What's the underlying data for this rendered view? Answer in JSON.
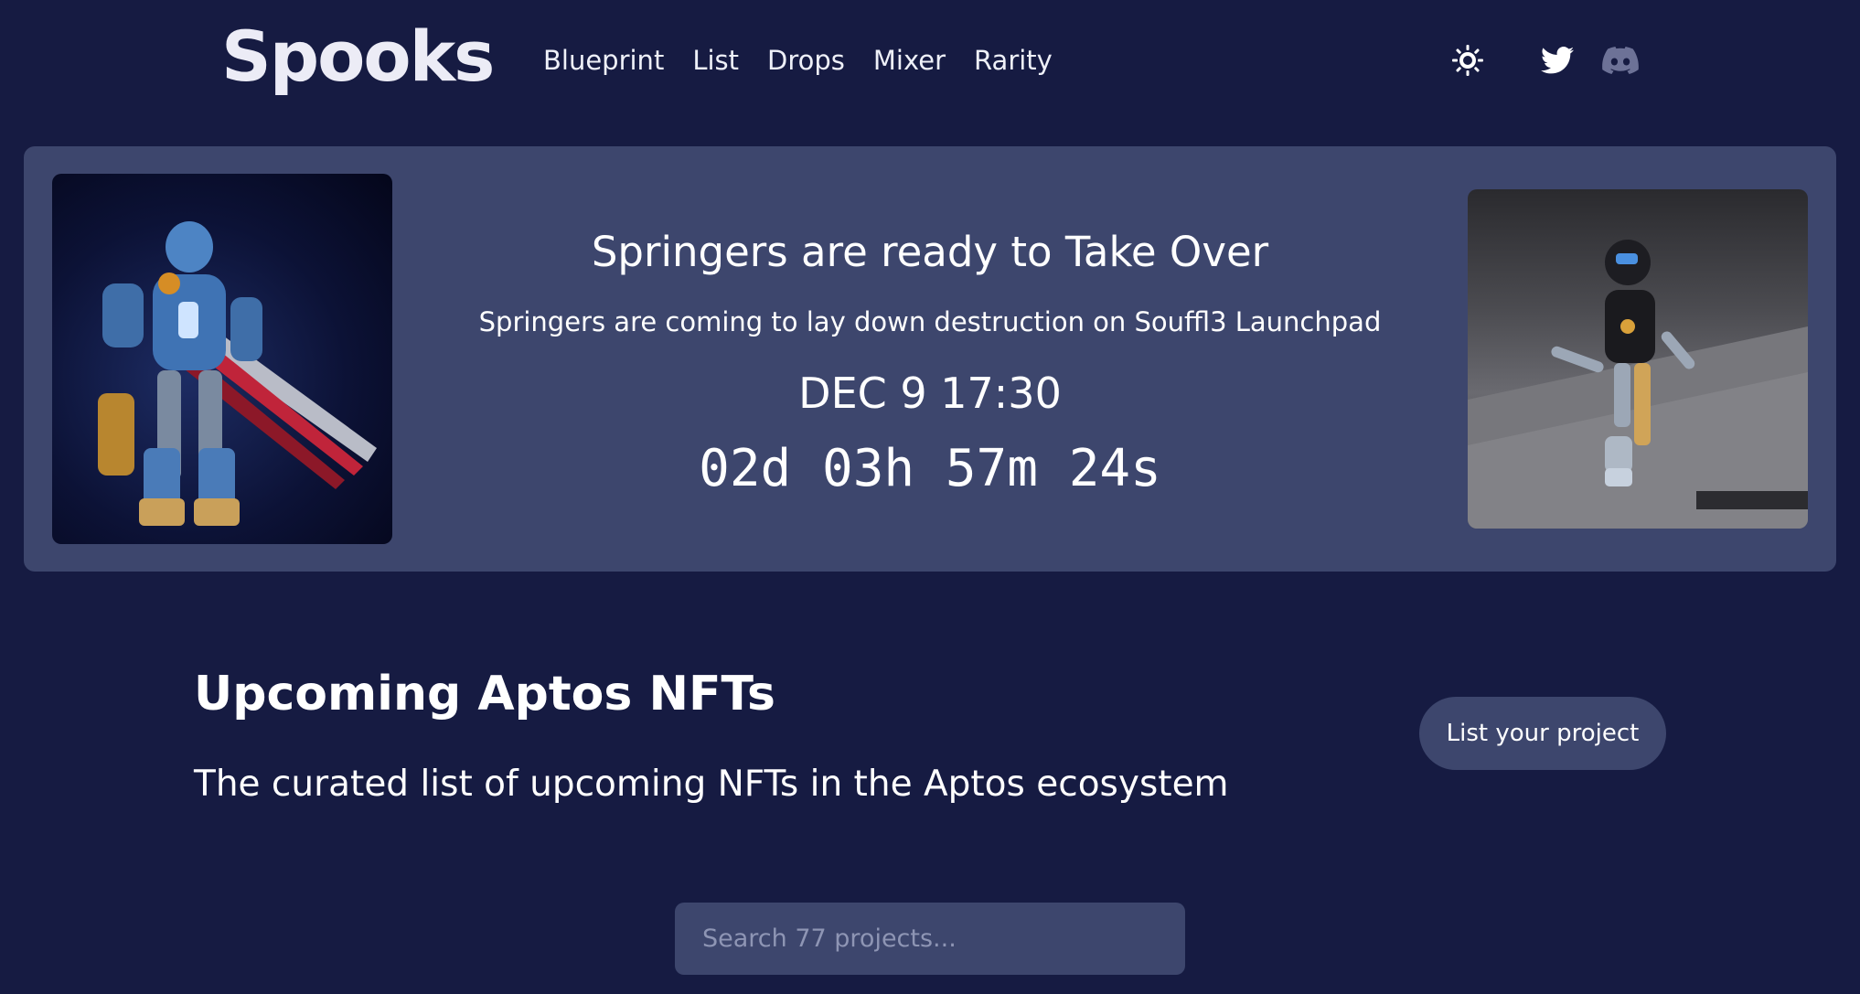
{
  "header": {
    "logo": "Spooks",
    "nav": [
      "Blueprint",
      "List",
      "Drops",
      "Mixer",
      "Rarity"
    ],
    "icons": [
      "theme-sun-icon",
      "twitter-icon",
      "discord-icon"
    ]
  },
  "banner": {
    "title": "Springers are ready to Take Over",
    "subtitle": "Springers are coming to lay down destruction on Souffl3 Launchpad",
    "date": "DEC 9 17:30",
    "countdown": "02d 03h 57m 24s",
    "left_image": "robot-with-sword-image",
    "right_image": "robot-walking-image"
  },
  "intro": {
    "title": "Upcoming Aptos NFTs",
    "description": "The curated list of upcoming NFTs in the Aptos ecosystem",
    "list_button": "List your project"
  },
  "search": {
    "placeholder": "Search 77 projects...",
    "value": ""
  },
  "colors": {
    "background": "#161b42",
    "card": "#3d466d",
    "text": "#ffffff"
  }
}
